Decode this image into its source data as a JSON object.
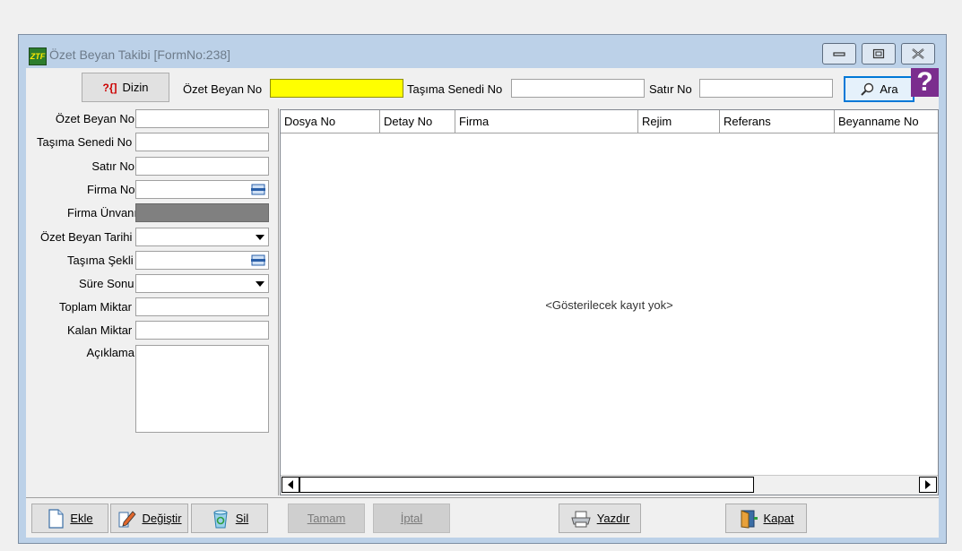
{
  "window": {
    "title": "Özet Beyan Takibi [FormNo:238]",
    "app_icon_text": "ZTF"
  },
  "toolbar": {
    "dizin_label": "Dizin",
    "ozet_beyan_no_label": "Özet Beyan No",
    "ozet_beyan_no_value": "",
    "tasima_senedi_no_label": "Taşıma Senedi No",
    "tasima_senedi_no_value": "",
    "satir_no_label": "Satır No",
    "satir_no_value": "",
    "ara_label": "Ara",
    "help_label": "?"
  },
  "form": {
    "fields": [
      {
        "label": "Özet Beyan No",
        "value": ""
      },
      {
        "label": "Taşıma Senedi No",
        "value": ""
      },
      {
        "label": "Satır No",
        "value": ""
      },
      {
        "label": "Firma No",
        "value": ""
      },
      {
        "label": "Firma Ünvanı",
        "value": ""
      },
      {
        "label": "Özet Beyan Tarihi",
        "value": ""
      },
      {
        "label": "Taşıma Şekli",
        "value": ""
      },
      {
        "label": "Süre Sonu",
        "value": ""
      },
      {
        "label": "Toplam Miktar",
        "value": ""
      },
      {
        "label": "Kalan Miktar",
        "value": ""
      },
      {
        "label": "Açıklama",
        "value": ""
      }
    ]
  },
  "grid": {
    "columns": [
      "Dosya No",
      "Detay No",
      "Firma",
      "Rejim",
      "Referans",
      "Beyanname No"
    ],
    "empty_message": "<Gösterilecek kayıt yok>"
  },
  "actions": {
    "ekle": "Ekle",
    "degistir": "Değiştir",
    "sil": "Sil",
    "tamam": "Tamam",
    "iptal": "İptal",
    "yazdir": "Yazdır",
    "kapat": "Kapat"
  },
  "colors": {
    "highlight_input": "#ffff00",
    "help_badge": "#7b2d8e",
    "readonly_field": "#808080"
  }
}
